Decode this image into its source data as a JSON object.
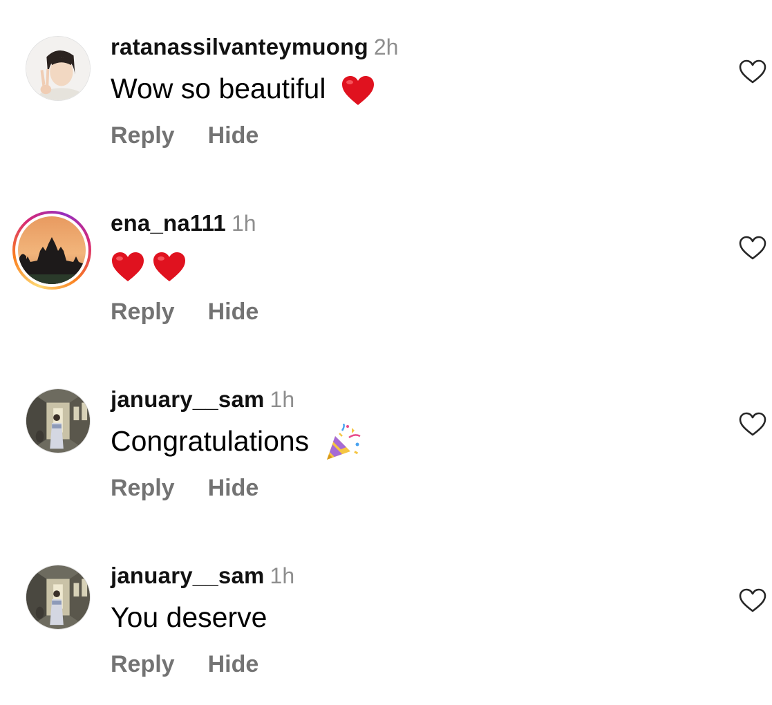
{
  "comments": [
    {
      "username": "ratanassilvanteymuong",
      "time": "2h",
      "text": "Wow so beautiful",
      "emoji": [
        "red-heart"
      ],
      "reply_label": "Reply",
      "hide_label": "Hide",
      "avatar": "girl-peace-sign-photo",
      "story_ring": false
    },
    {
      "username": "ena_na111",
      "time": "1h",
      "text": "",
      "emoji": [
        "red-heart",
        "red-heart"
      ],
      "reply_label": "Reply",
      "hide_label": "Hide",
      "avatar": "temple-sunset-photo",
      "story_ring": true
    },
    {
      "username": "january__sam",
      "time": "1h",
      "text": "Congratulations",
      "emoji": [
        "party-popper"
      ],
      "reply_label": "Reply",
      "hide_label": "Hide",
      "avatar": "corridor-photo",
      "story_ring": false
    },
    {
      "username": "january__sam",
      "time": "1h",
      "text": "You deserve",
      "emoji": [],
      "reply_label": "Reply",
      "hide_label": "Hide",
      "avatar": "corridor-photo",
      "story_ring": false
    }
  ],
  "icons": {
    "like": "heart-outline-icon"
  },
  "colors": {
    "username": "#111111",
    "timestamp": "#8e8e8e",
    "action_text": "#737373",
    "heart_emoji": "#e0121f",
    "background": "#ffffff"
  }
}
